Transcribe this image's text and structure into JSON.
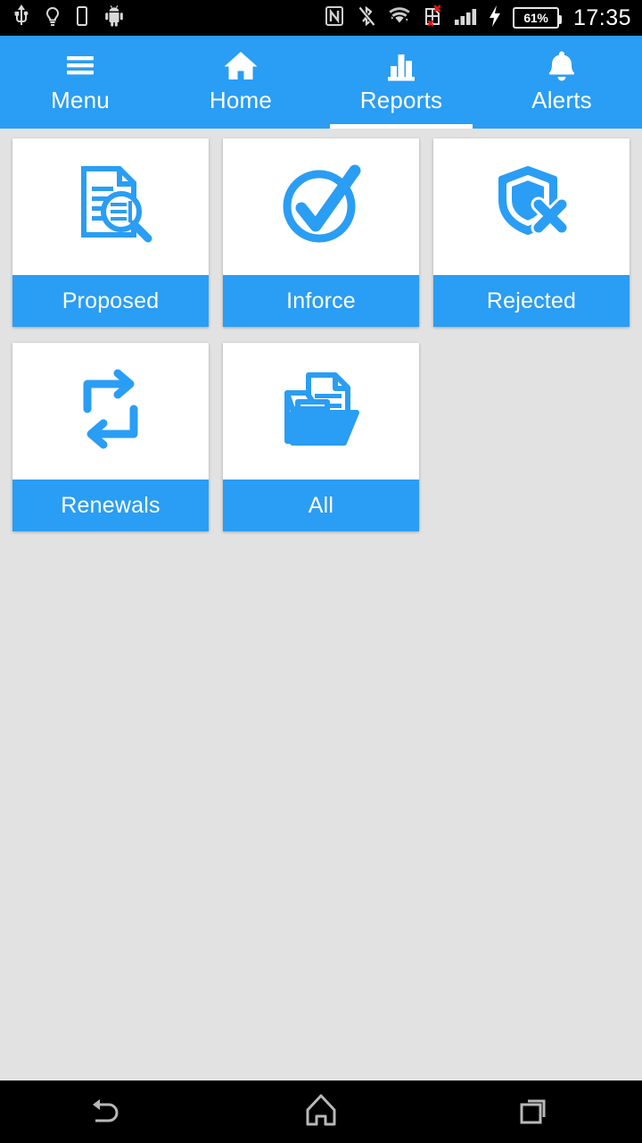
{
  "status_bar": {
    "time": "17:35",
    "battery_percent": "61%",
    "left_icons": [
      "usb-icon",
      "lightbulb-icon",
      "sim-card-icon",
      "android-robot-icon"
    ],
    "right_icons": [
      "nfc-icon",
      "bluetooth-off-icon",
      "wifi-icon",
      "sim-error-icon",
      "signal-bars-icon",
      "charging-bolt-icon",
      "battery-icon"
    ]
  },
  "tabs": [
    {
      "label": "Menu",
      "icon": "hamburger-menu-icon",
      "active": false
    },
    {
      "label": "Home",
      "icon": "home-icon",
      "active": false
    },
    {
      "label": "Reports",
      "icon": "bar-chart-icon",
      "active": true
    },
    {
      "label": "Alerts",
      "icon": "bell-icon",
      "active": false
    }
  ],
  "report_cards": [
    {
      "label": "Proposed",
      "icon": "document-search-icon"
    },
    {
      "label": "Inforce",
      "icon": "check-circle-icon"
    },
    {
      "label": "Rejected",
      "icon": "shield-x-icon"
    },
    {
      "label": "Renewals",
      "icon": "repeat-arrows-icon"
    },
    {
      "label": "All",
      "icon": "folder-document-icon"
    }
  ],
  "nav_bar": [
    {
      "name": "back-button",
      "icon": "back-arrow-icon"
    },
    {
      "name": "home-button",
      "icon": "home-outline-icon"
    },
    {
      "name": "recents-button",
      "icon": "recents-squares-icon"
    }
  ],
  "colors": {
    "accent": "#2a9df4",
    "background": "#e2e2e2",
    "card": "#ffffff",
    "status_bar": "#000000",
    "text_on_accent": "#ffffff"
  }
}
